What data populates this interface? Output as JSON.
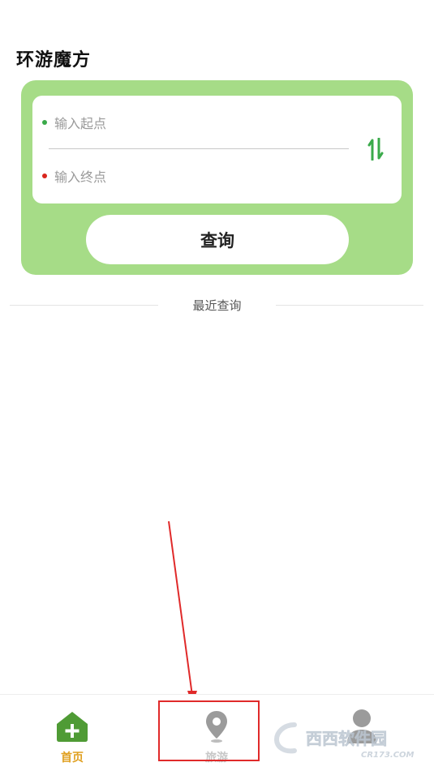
{
  "app": {
    "title": "环游魔方"
  },
  "route": {
    "start_placeholder": "输入起点",
    "end_placeholder": "输入终点",
    "query_label": "查询",
    "swap_icon": "swap-vertical-icon"
  },
  "recent": {
    "label": "最近查询"
  },
  "tabbar": {
    "items": [
      {
        "label": "首页",
        "icon": "home-plus-icon",
        "active": true,
        "color": "#e0a020"
      },
      {
        "label": "旅游",
        "icon": "location-pin-icon",
        "active": false
      },
      {
        "label": "",
        "icon": "person-icon",
        "active": false
      }
    ]
  },
  "watermark": {
    "brand": "西西软件园",
    "site": "CR173.COM"
  },
  "colors": {
    "card": "#a6dc87",
    "accent": "#3aaa4a",
    "annotation": "#e02a2a"
  }
}
